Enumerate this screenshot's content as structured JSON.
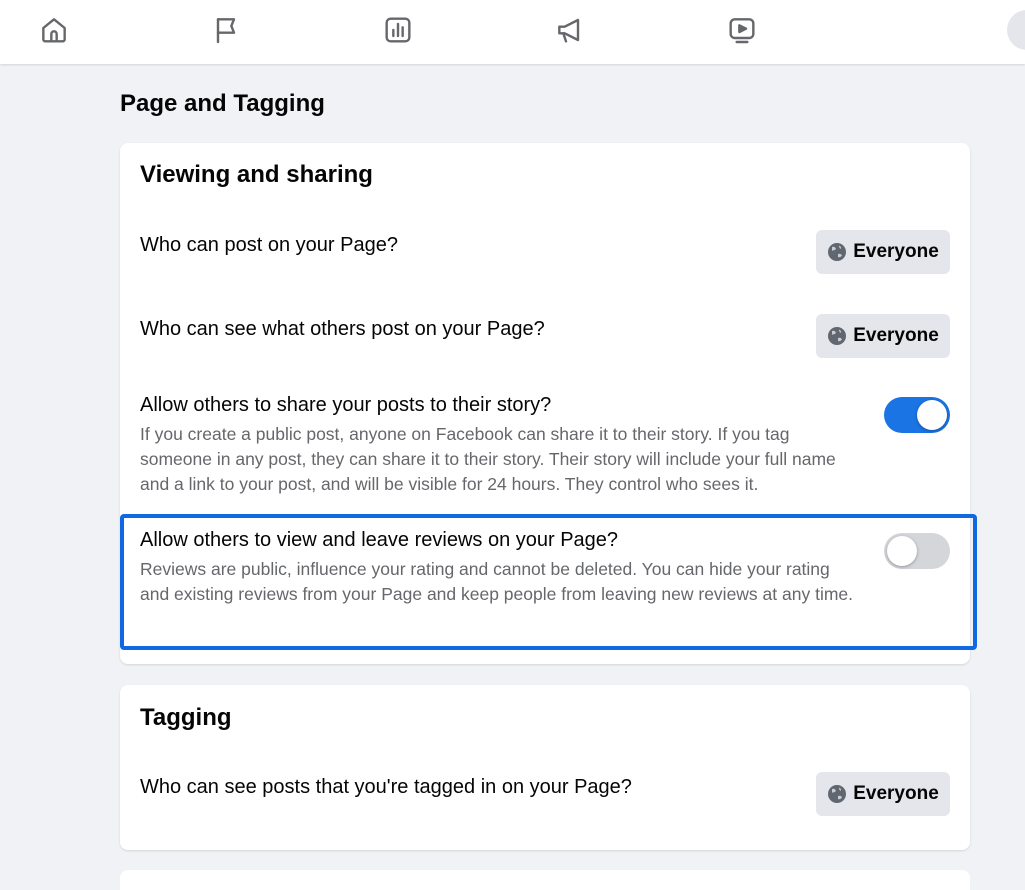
{
  "nav": {
    "icons": [
      "home-icon",
      "flag-icon",
      "insights-icon",
      "megaphone-icon",
      "video-icon"
    ]
  },
  "page_title": "Page and Tagging",
  "sections": {
    "viewing": {
      "title": "Viewing and sharing",
      "who_can_post": {
        "label": "Who can post on your Page?",
        "value": "Everyone"
      },
      "who_can_see_others": {
        "label": "Who can see what others post on your Page?",
        "value": "Everyone"
      },
      "share_to_story": {
        "label": "Allow others to share your posts to their story?",
        "description": "If you create a public post, anyone on Facebook can share it to their story. If you tag someone in any post, they can share it to their story. Their story will include your full name and a link to your post, and will be visible for 24 hours. They control who sees it.",
        "enabled": true
      },
      "reviews": {
        "label": "Allow others to view and leave reviews on your Page?",
        "description": "Reviews are public, influence your rating and cannot be deleted. You can hide your rating and existing reviews from your Page and keep people from leaving new reviews at any time.",
        "enabled": false
      }
    },
    "tagging": {
      "title": "Tagging",
      "tagged_posts": {
        "label": "Who can see posts that you're tagged in on your Page?",
        "value": "Everyone"
      }
    }
  },
  "colors": {
    "accent": "#1b74e4",
    "highlight_border": "#1168e3",
    "background": "#f0f2f5"
  }
}
